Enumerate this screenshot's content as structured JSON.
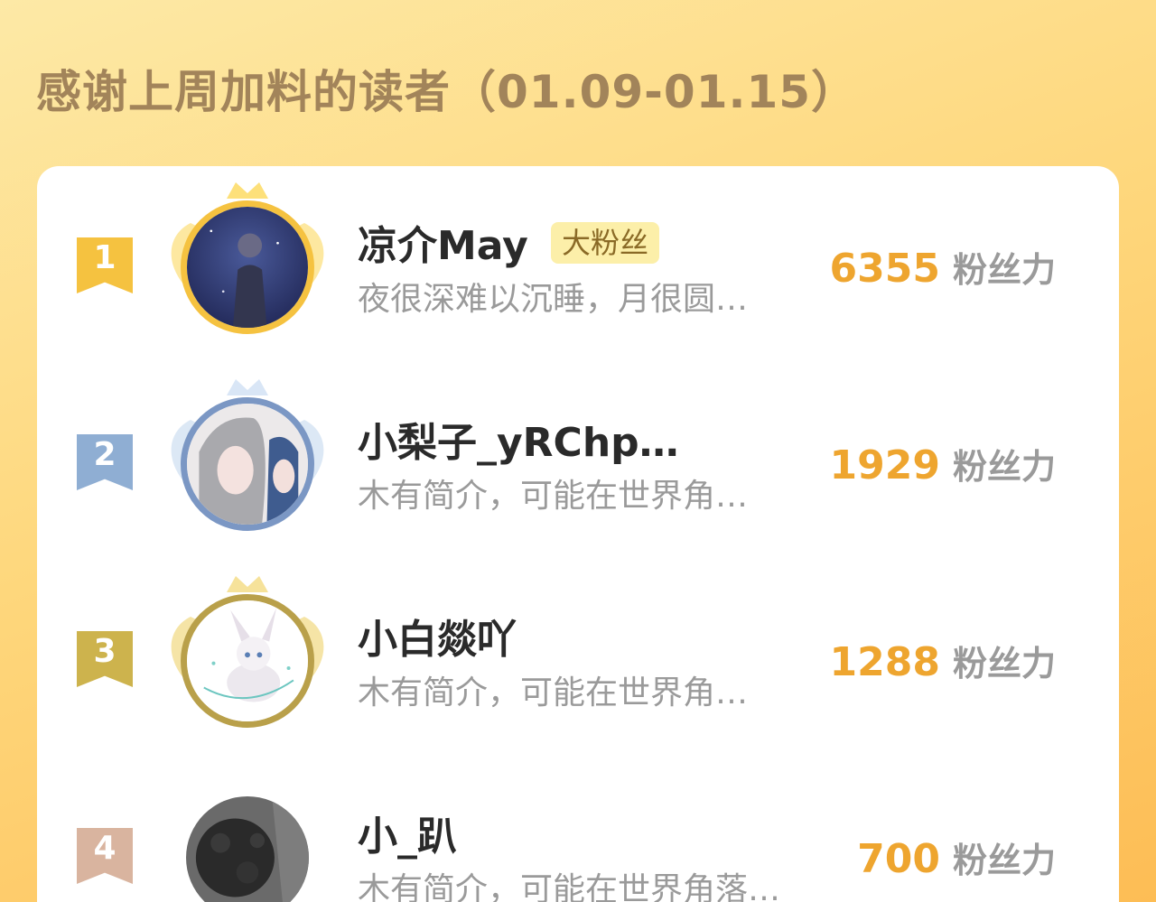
{
  "header": {
    "title": "感谢上周加料的读者（01.09-01.15）"
  },
  "colors": {
    "gold": "#f5c240",
    "silver": "#8faed3",
    "bronze": "#cdb34d",
    "fourth": "#d9b49f",
    "score": "#eea52f"
  },
  "readers": [
    {
      "rank": "1",
      "name": "凉介May",
      "badge": "大粉丝",
      "bio": "夜很深难以沉睡，月很圆…",
      "score": "6355",
      "unit": "粉丝力"
    },
    {
      "rank": "2",
      "name": "小梨子_yRChp…",
      "bio": "木有简介，可能在世界角…",
      "score": "1929",
      "unit": "粉丝力"
    },
    {
      "rank": "3",
      "name": "小白燚吖",
      "bio": "木有简介，可能在世界角…",
      "score": "1288",
      "unit": "粉丝力"
    },
    {
      "rank": "4",
      "name": "小_趴",
      "bio": "木有简介，可能在世界角落…",
      "score": "700",
      "unit": "粉丝力"
    }
  ]
}
